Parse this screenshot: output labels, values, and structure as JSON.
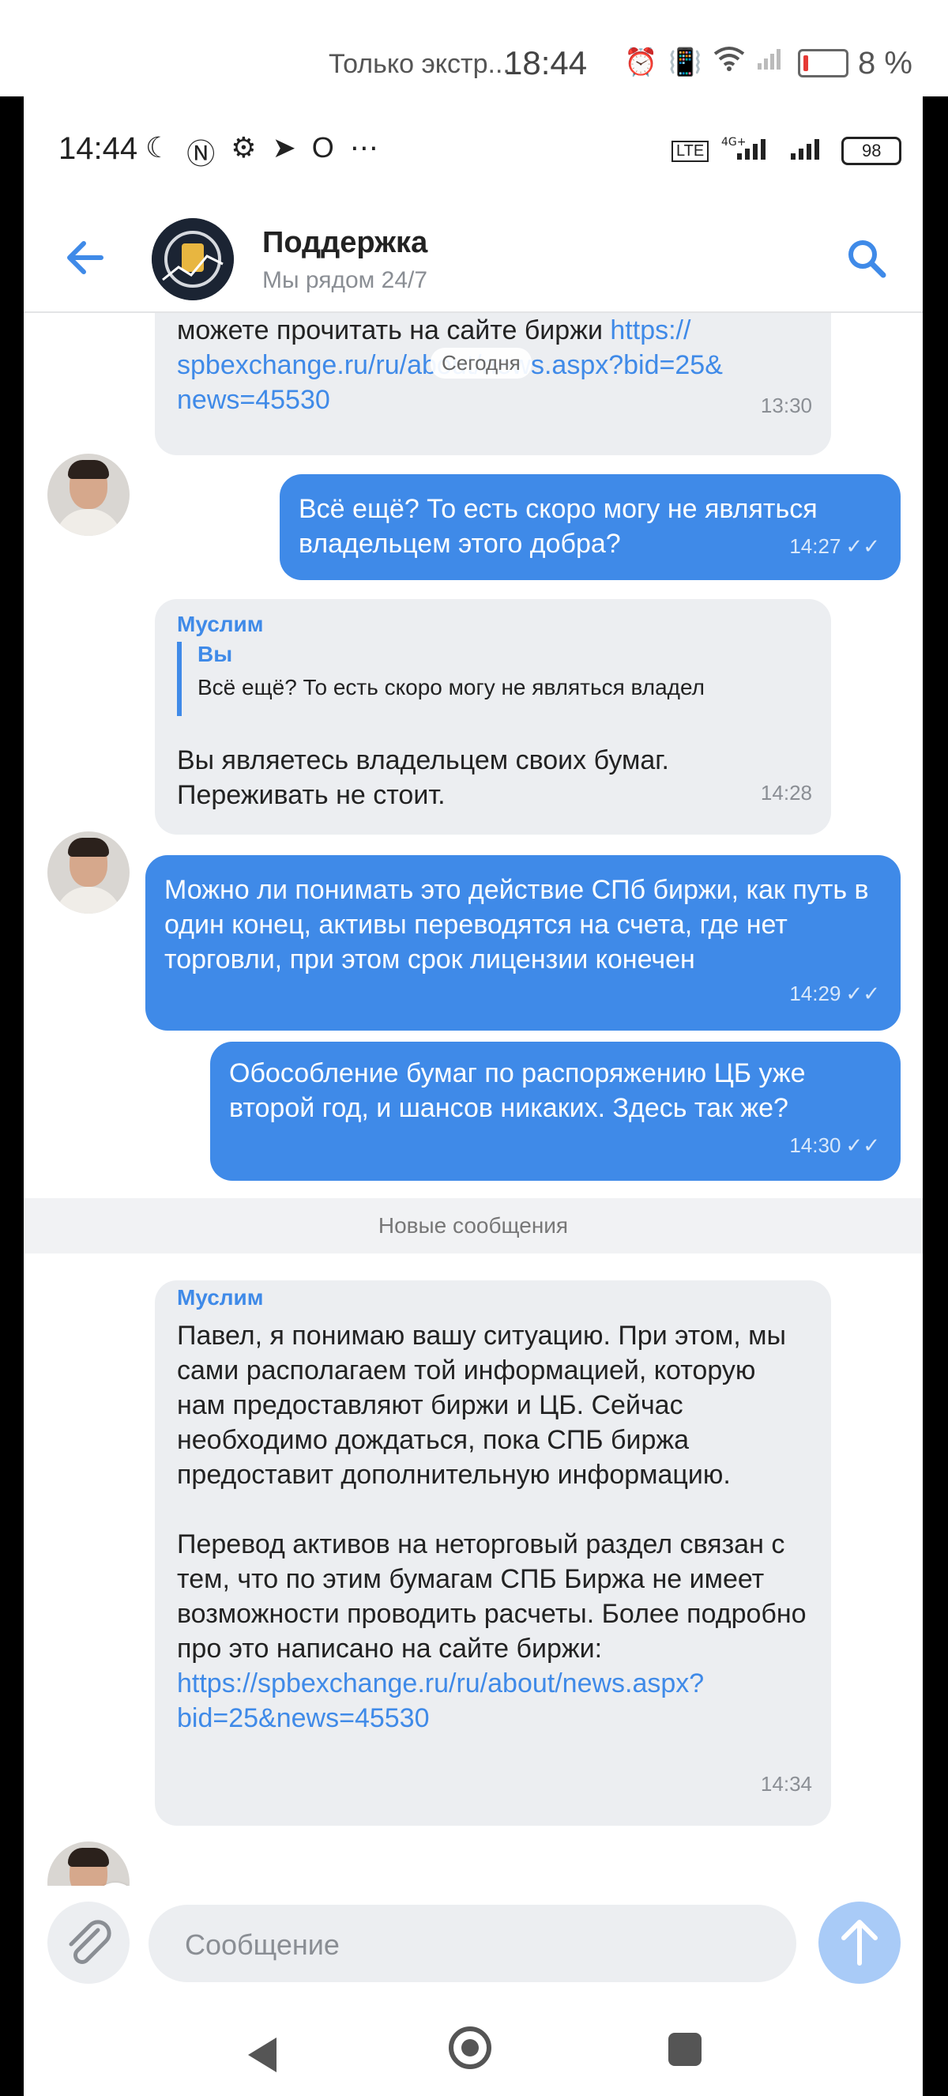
{
  "outer_status": {
    "notice": "Только экстр...",
    "clock": "18:44",
    "battery_pct": "8 %"
  },
  "inner_status": {
    "clock": "14:44",
    "battery": "98"
  },
  "header": {
    "title": "Поддержка",
    "subtitle": "Мы рядом 24/7"
  },
  "date_divider": "Сегодня",
  "messages": {
    "m1": {
      "line1_text": "можете прочитать на сайте биржи ",
      "line1_link": "https://",
      "line2_link": "spbexchange.ru/ru/about/news.aspx?bid=25&",
      "line3_link": "news=45530",
      "time": "13:30"
    },
    "m2": {
      "text": "Всё ещё? То есть скоро могу не являться владельцем этого добра?",
      "time": "14:27"
    },
    "m3": {
      "sender": "Муслим",
      "reply_name": "Вы",
      "reply_text": "Всё ещё? То есть скоро могу не являться владел",
      "text": "Вы являетесь владельцем своих бумаг. Переживать не стоит.",
      "time": "14:28"
    },
    "m4": {
      "text": "Можно ли понимать это действие СПб биржи, как путь в один конец, активы переводятся на счета, где нет торговли, при этом срок лицензии конечен",
      "time": "14:29"
    },
    "m5": {
      "text": "Обособление бумаг по распоряжению ЦБ уже второй год, и шансов никаких. Здесь так же?",
      "time": "14:30"
    },
    "m6": {
      "sender": "Муслим",
      "para1": "Павел, я понимаю вашу ситуацию. При этом, мы сами располагаем той информацией, которую нам предоставляют биржи и ЦБ. Сейчас необходимо дождаться, пока СПБ биржа предоставит дополнительную информацию.",
      "para2": "Перевод активов на неторговый раздел связан с тем, что по этим бумагам СПБ Биржа не имеет возможности проводить расчеты. Более подробно про это написано на сайте биржи: ",
      "link": "https://spbexchange.ru/ru/about/news.aspx?bid=25&news=45530",
      "time": "14:34"
    }
  },
  "new_messages_label": "Новые сообщения",
  "composer": {
    "placeholder": "Сообщение"
  },
  "icons": {
    "back": "arrow-left-icon",
    "search": "search-icon",
    "attach": "paperclip-icon",
    "send": "arrow-up-icon",
    "read": "double-check-icon"
  },
  "colors": {
    "accent": "#3f8ae8",
    "incoming_bubble": "#eceef1",
    "send_button": "#a9cbf7"
  }
}
